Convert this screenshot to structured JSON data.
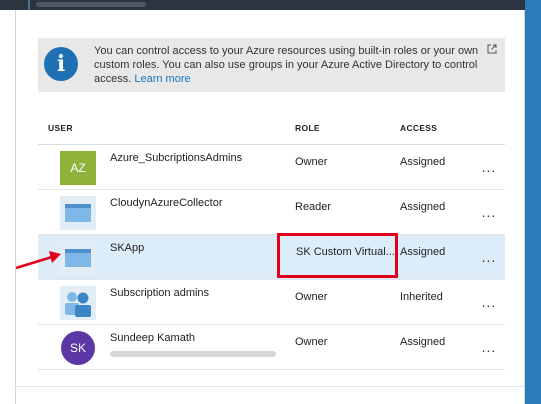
{
  "info": {
    "text": "You can control access to your Azure resources using built-in roles or your own custom roles. You can also use groups in your Azure Active Directory to control access.",
    "learn_more": "Learn more"
  },
  "columns": {
    "user": "USER",
    "role": "ROLE",
    "access": "ACCESS"
  },
  "rows": [
    {
      "avatar_text": "AZ",
      "avatar_color": "#8fb33a",
      "name": "Azure_SubcriptionsAdmins",
      "role": "Owner",
      "access": "Assigned",
      "more": "..."
    },
    {
      "avatar_icon": "app-window-icon",
      "name": "CloudynAzureCollector",
      "role": "Reader",
      "access": "Assigned",
      "more": "..."
    },
    {
      "avatar_icon": "app-window-icon",
      "name": "SKApp",
      "role": "SK Custom Virtual...",
      "access": "Assigned",
      "more": "...",
      "selected": true
    },
    {
      "avatar_icon": "group-icon",
      "name": "Subscription admins",
      "role": "Owner",
      "access": "Inherited",
      "more": "..."
    },
    {
      "avatar_text": "SK",
      "avatar_color": "#5c37a6",
      "name": "Sundeep Kamath",
      "role": "Owner",
      "access": "Assigned",
      "more": "..."
    }
  ],
  "colors": {
    "accent": "#1f6fb3",
    "selected_row": "#dcecf9",
    "annotation": "#e3001b"
  }
}
